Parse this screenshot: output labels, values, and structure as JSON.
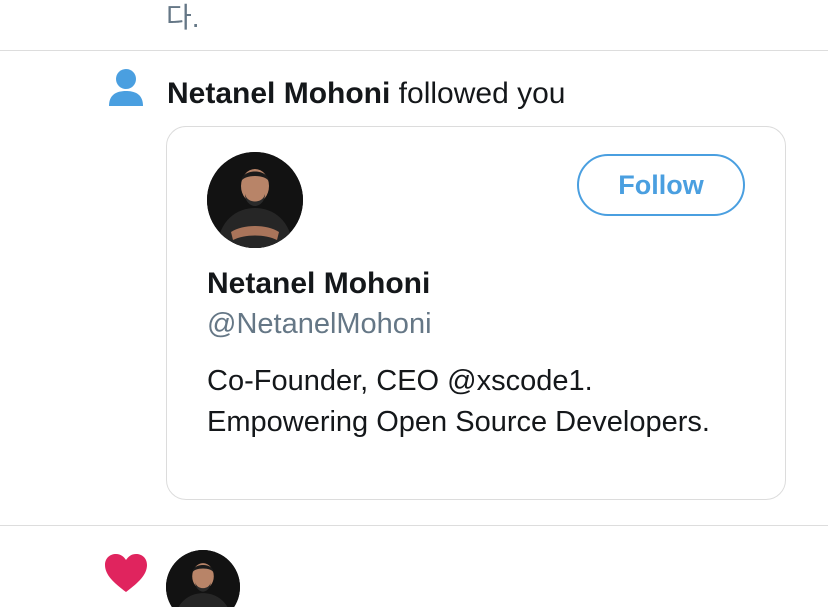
{
  "top_fragment": "다.",
  "notification": {
    "name": "Netanel Mohoni",
    "action": " followed you"
  },
  "card": {
    "follow_label": "Follow",
    "name": "Netanel Mohoni",
    "handle": "@NetanelMohoni",
    "bio": "Co-Founder, CEO @xscode1. Empowering Open Source Developers."
  },
  "icons": {
    "follow_notification": "person-icon",
    "like_notification": "heart-icon"
  },
  "colors": {
    "accent_blue": "#4a9fe0",
    "person_icon": "#4a9fe0",
    "heart": "#e0245e",
    "secondary_text": "#657786"
  }
}
